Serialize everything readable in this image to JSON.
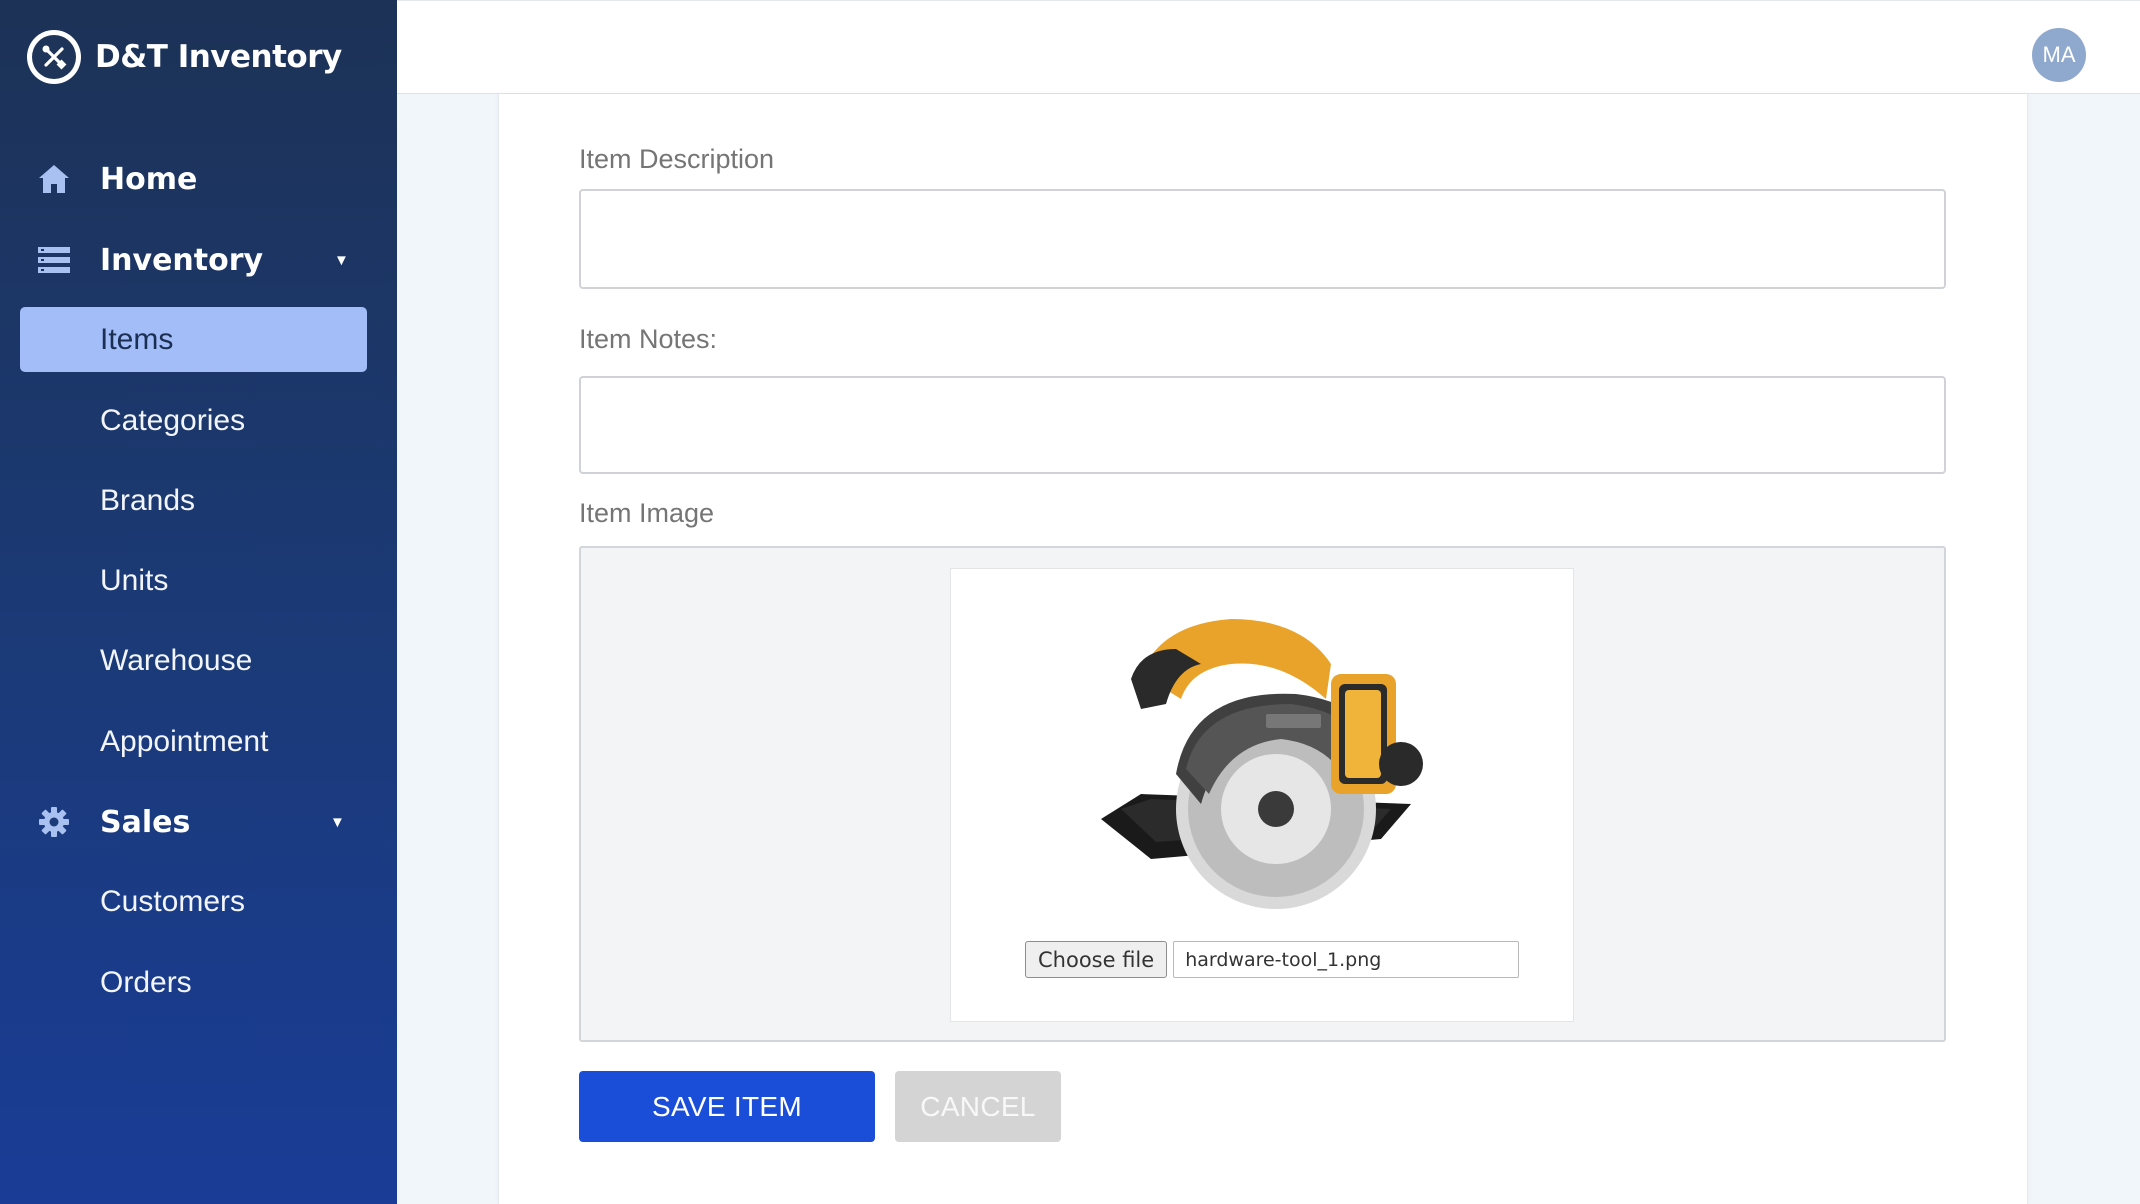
{
  "app": {
    "name": "D&T Inventory"
  },
  "sidebar": {
    "home": "Home",
    "inventory": "Inventory",
    "inventory_items": [
      "Items",
      "Categories",
      "Brands",
      "Units",
      "Warehouse",
      "Appointment"
    ],
    "sales": "Sales",
    "sales_items": [
      "Customers",
      "Orders"
    ],
    "active_item": "Items"
  },
  "header": {
    "avatar_initials": "MA"
  },
  "form": {
    "description_label": "Item Description",
    "description_value": "",
    "notes_label": "Item Notes:",
    "notes_value": "",
    "image_label": "Item Image",
    "choose_file_label": "Choose file",
    "file_name": "hardware-tool_1.png",
    "save_label": "SAVE ITEM",
    "cancel_label": "CANCEL"
  },
  "colors": {
    "sidebar_top": "#1c3256",
    "sidebar_bottom": "#1a3c96",
    "active_item_bg": "#a2bdf7",
    "primary": "#1b4ed8",
    "disabled": "#d4d4d4"
  }
}
